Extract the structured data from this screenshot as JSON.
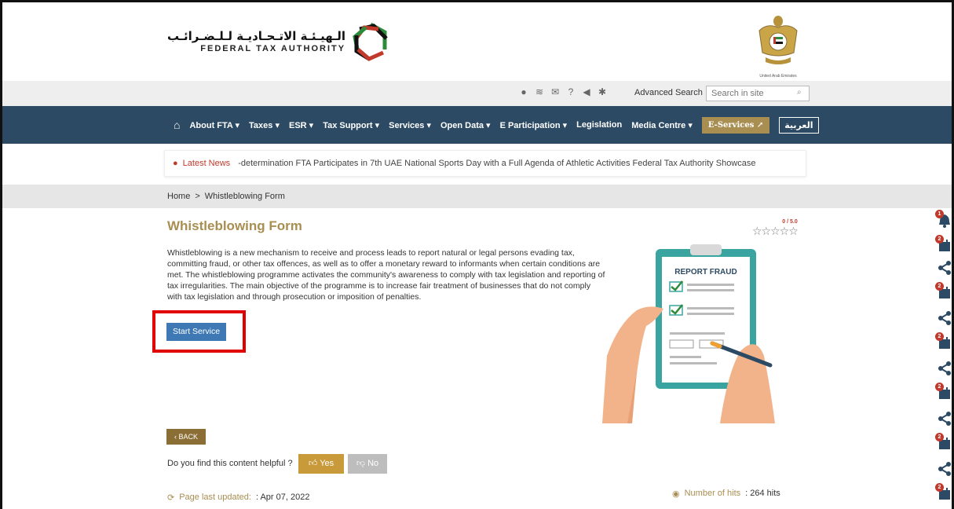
{
  "header": {
    "fta_arabic": "الـهيـئـة الاتـحـاديـة لـلـضـرائـب",
    "fta_english": "FEDERAL TAX AUTHORITY",
    "emblem_caption": "United Arab Emirates"
  },
  "utility": {
    "advanced_search": "Advanced Search",
    "search_placeholder": "Search in site"
  },
  "nav": {
    "items": [
      "About FTA ▾",
      "Taxes ▾",
      "ESR ▾",
      "Tax Support ▾",
      "Services ▾",
      "Open Data ▾",
      "E Participation ▾",
      "Legislation",
      "Media Centre ▾"
    ],
    "eservices": "E-Services",
    "arabic": "العربية"
  },
  "news": {
    "label": "Latest News",
    "ticker": "-determination    FTA Participates in 7th UAE National Sports Day with a Full Agenda of Athletic Activities    Federal Tax Authority Showcase"
  },
  "breadcrumb": {
    "home": "Home",
    "sep": ">",
    "current": "Whistleblowing Form"
  },
  "content": {
    "title": "Whistleblowing Form",
    "rating_value": "0 / 5.0",
    "rating_stars": "☆☆☆☆☆",
    "description": "Whistleblowing is a new mechanism to receive and process leads to report natural or legal persons evading tax, committing fraud, or other tax offences, as well as to offer a monetary reward to informants when certain conditions are met. The whistleblowing programme activates the community's awareness to comply with tax legislation and reporting of tax irregularities. The main objective of the programme is to increase fair treatment of businesses that do not comply with tax legislation and through prosecution or imposition of penalties.",
    "start_button": "Start Service",
    "illustration_label": "REPORT FRAUD",
    "back_button": "‹ BACK",
    "helpful_question": "Do you find this content helpful ?",
    "yes_label": "Yes",
    "no_label": "No",
    "updated_label": "Page last updated:",
    "updated_date": ": Apr 07, 2022",
    "hits_label": "Number of hits",
    "hits_value": ": 264 hits"
  },
  "side": {
    "badges": [
      "1",
      "2",
      "2",
      "2",
      "2",
      "2",
      "2"
    ]
  },
  "colors": {
    "nav_bg": "#2c4a63",
    "accent_gold": "#a98e52",
    "start_blue": "#3f79b5",
    "highlight_red": "#e00000"
  }
}
